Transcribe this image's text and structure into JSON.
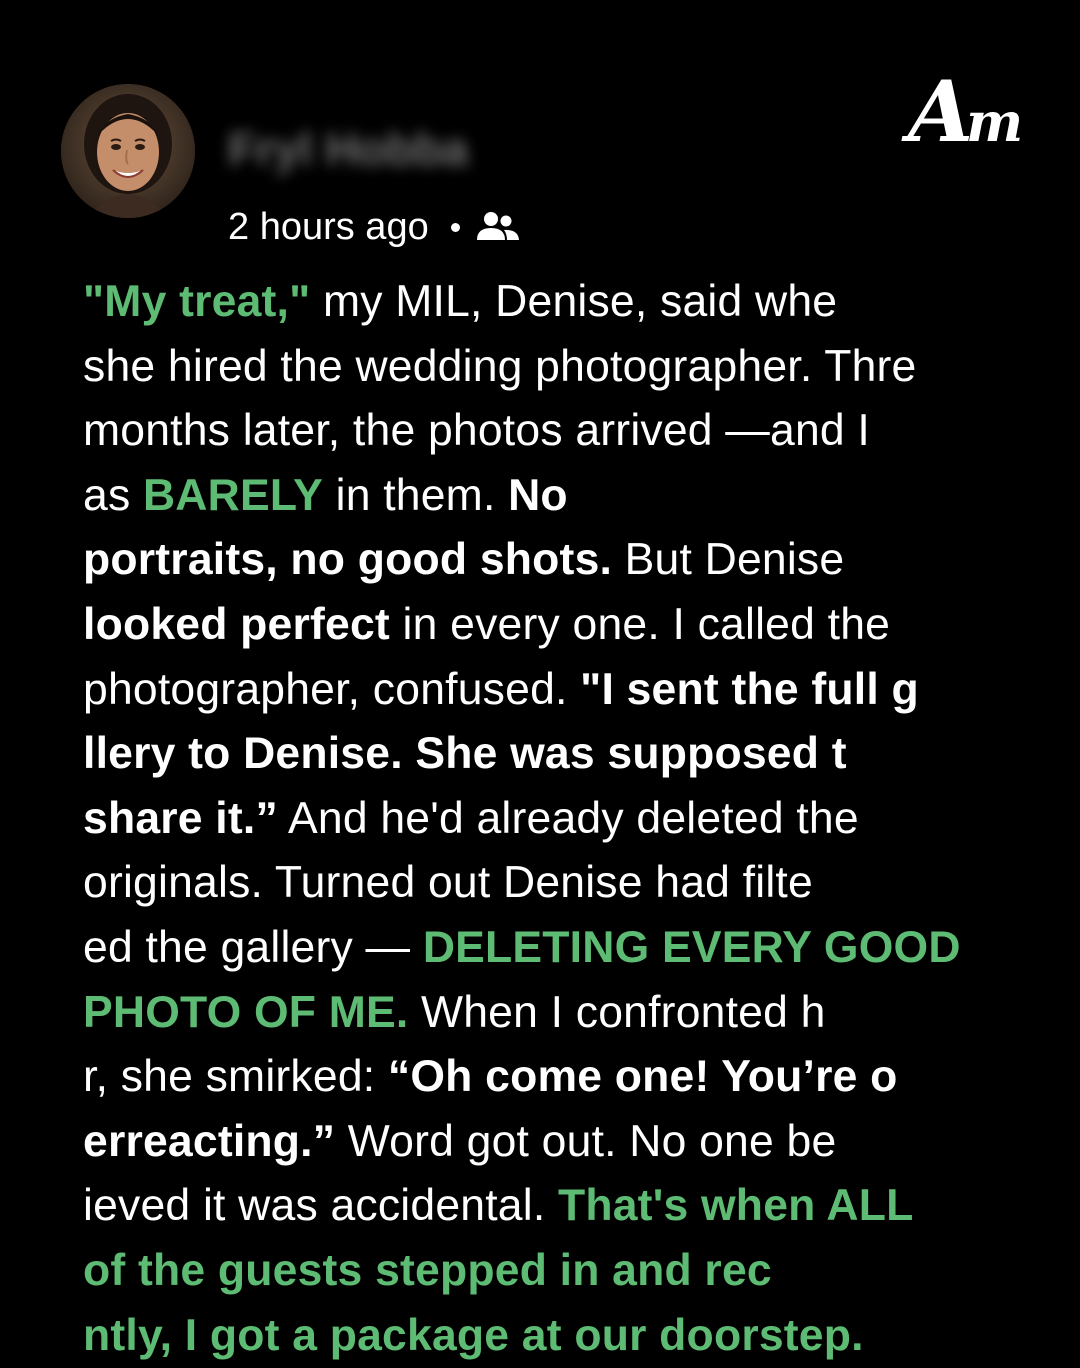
{
  "post": {
    "author_name": "Fryl Hobba",
    "timestamp": "2 hours ago",
    "separator": "•",
    "audience_icon": "friends-icon",
    "avatar_icon": "profile-photo",
    "brand_logo_icon": "am-logo",
    "brand_logo_letters": {
      "a": "A",
      "m": "m"
    }
  },
  "colors": {
    "background": "#000000",
    "text": "#ffffff",
    "accent_green": "#5dbb73"
  },
  "story": {
    "segments": [
      {
        "text": "\"My treat,\"",
        "style": "green-bold"
      },
      {
        "text": " my MIL, Denise, said when she hired the wedding photographer. Three months later, the photos arrived —and I was ",
        "style": "normal"
      },
      {
        "text": "BARELY",
        "style": "green-bold"
      },
      {
        "text": " in them. ",
        "style": "normal"
      },
      {
        "text": "No portraits, no good shots.",
        "style": "bold"
      },
      {
        "text": " But Denise ",
        "style": "normal"
      },
      {
        "text": "looked perfect",
        "style": "bold"
      },
      {
        "text": " in every one. I called the photographer, confused. ",
        "style": "normal"
      },
      {
        "text": "\"I sent the full gallery to Denise. She was supposed to share it.”",
        "style": "bold"
      },
      {
        "text": " And he'd already deleted the originals. Turned out Denise had filtered the gallery — ",
        "style": "normal"
      },
      {
        "text": "DELETING EVERY GOOD PHOTO OF ME.",
        "style": "green-bold"
      },
      {
        "text": " When I confronted her, she smirked: ",
        "style": "normal"
      },
      {
        "text": "“Oh come one! You’re overreacting.”",
        "style": "bold"
      },
      {
        "text": " Word got out. No one believed it was accidental. ",
        "style": "normal"
      },
      {
        "text": "That's when ALL of the guests stepped in and recently, I got a package at our doorstep.",
        "style": "green-bold"
      }
    ]
  }
}
